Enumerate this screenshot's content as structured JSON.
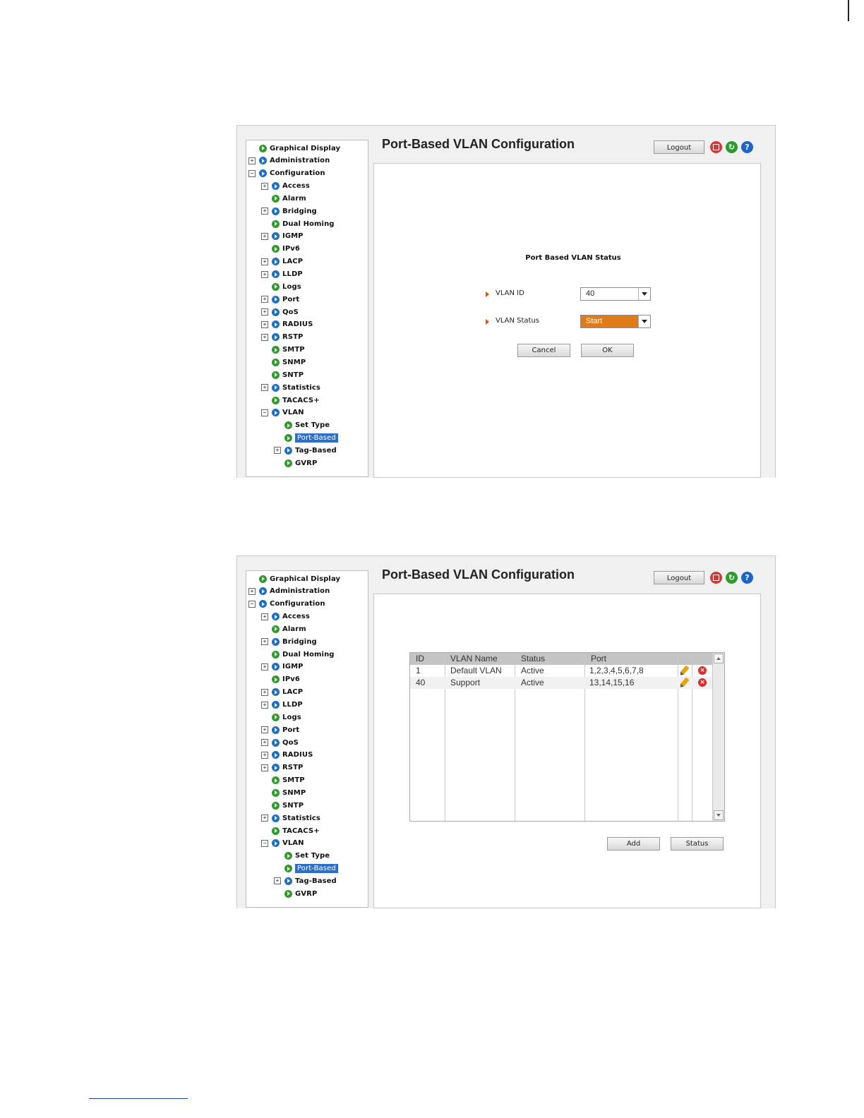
{
  "common": {
    "page_title": "Port-Based VLAN Configuration",
    "logout_label": "Logout",
    "header_icons": [
      "save-icon",
      "refresh-icon",
      "help-icon"
    ],
    "tree": [
      {
        "label": "Graphical Display",
        "expander": "",
        "icon": "green"
      },
      {
        "label": "Administration",
        "expander": "+",
        "icon": "blue"
      },
      {
        "label": "Configuration",
        "expander": "−",
        "icon": "blue"
      },
      {
        "label": "Access",
        "expander": "+",
        "icon": "blue"
      },
      {
        "label": "Alarm",
        "expander": "",
        "icon": "green"
      },
      {
        "label": "Bridging",
        "expander": "+",
        "icon": "blue"
      },
      {
        "label": "Dual Homing",
        "expander": "",
        "icon": "green"
      },
      {
        "label": "IGMP",
        "expander": "+",
        "icon": "blue"
      },
      {
        "label": "IPv6",
        "expander": "",
        "icon": "green"
      },
      {
        "label": "LACP",
        "expander": "+",
        "icon": "blue"
      },
      {
        "label": "LLDP",
        "expander": "+",
        "icon": "blue"
      },
      {
        "label": "Logs",
        "expander": "",
        "icon": "green"
      },
      {
        "label": "Port",
        "expander": "+",
        "icon": "blue"
      },
      {
        "label": "QoS",
        "expander": "+",
        "icon": "blue"
      },
      {
        "label": "RADIUS",
        "expander": "+",
        "icon": "blue"
      },
      {
        "label": "RSTP",
        "expander": "+",
        "icon": "blue"
      },
      {
        "label": "SMTP",
        "expander": "",
        "icon": "green"
      },
      {
        "label": "SNMP",
        "expander": "",
        "icon": "green"
      },
      {
        "label": "SNTP",
        "expander": "",
        "icon": "green"
      },
      {
        "label": "Statistics",
        "expander": "+",
        "icon": "blue"
      },
      {
        "label": "TACACS+",
        "expander": "",
        "icon": "green"
      },
      {
        "label": "VLAN",
        "expander": "−",
        "icon": "blue"
      },
      {
        "label": "Set Type",
        "expander": "",
        "icon": "green"
      },
      {
        "label": "Port-Based",
        "expander": "",
        "icon": "green",
        "selected": true
      },
      {
        "label": "Tag-Based",
        "expander": "+",
        "icon": "blue"
      },
      {
        "label": "GVRP",
        "expander": "",
        "icon": "green"
      }
    ]
  },
  "status_form": {
    "heading": "Port Based VLAN Status",
    "vlan_id_label": "VLAN ID",
    "vlan_id_value": "40",
    "vlan_status_label": "VLAN Status",
    "vlan_status_value": "Start",
    "cancel_label": "Cancel",
    "ok_label": "OK"
  },
  "vlan_table": {
    "columns": [
      "ID",
      "VLAN Name",
      "Status",
      "Port",
      "",
      ""
    ],
    "rows": [
      {
        "id": "1",
        "name": "Default VLAN",
        "status": "Active",
        "port": "1,2,3,4,5,6,7,8"
      },
      {
        "id": "40",
        "name": "Support",
        "status": "Active",
        "port": "13,14,15,16"
      }
    ],
    "add_label": "Add",
    "status_label": "Status"
  },
  "colors": {
    "selected_item": "#2a6fc9",
    "status_select": "#e07b18",
    "bullet_arrow": "#d0561a"
  }
}
